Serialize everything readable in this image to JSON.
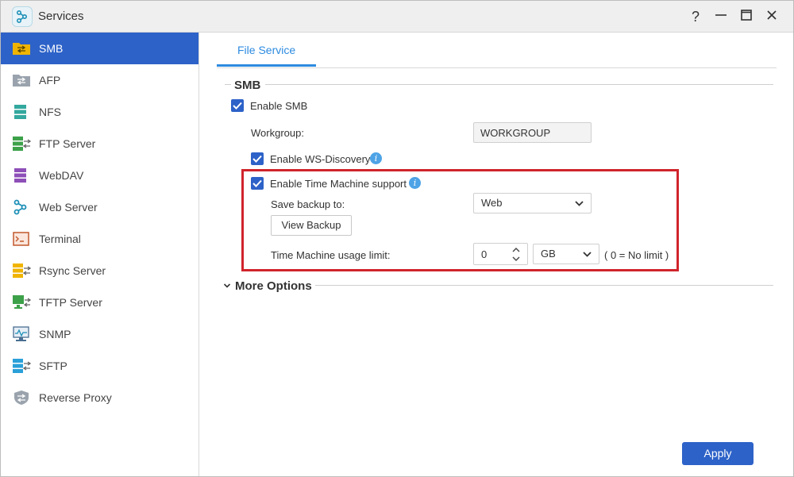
{
  "window": {
    "title": "Services",
    "controls": {
      "help": "?",
      "minimize": "—",
      "maximize": "☐",
      "close": "✕"
    }
  },
  "sidebar": {
    "items": [
      {
        "label": "SMB",
        "icon": "smb-icon",
        "active": true
      },
      {
        "label": "AFP",
        "icon": "afp-icon",
        "active": false
      },
      {
        "label": "NFS",
        "icon": "nfs-icon",
        "active": false
      },
      {
        "label": "FTP Server",
        "icon": "ftp-server-icon",
        "active": false
      },
      {
        "label": "WebDAV",
        "icon": "webdav-icon",
        "active": false
      },
      {
        "label": "Web Server",
        "icon": "web-server-icon",
        "active": false
      },
      {
        "label": "Terminal",
        "icon": "terminal-icon",
        "active": false
      },
      {
        "label": "Rsync Server",
        "icon": "rsync-server-icon",
        "active": false
      },
      {
        "label": "TFTP Server",
        "icon": "tftp-server-icon",
        "active": false
      },
      {
        "label": "SNMP",
        "icon": "snmp-icon",
        "active": false
      },
      {
        "label": "SFTP",
        "icon": "sftp-icon",
        "active": false
      },
      {
        "label": "Reverse Proxy",
        "icon": "reverse-proxy-icon",
        "active": false
      }
    ]
  },
  "tabs": [
    {
      "label": "File Service",
      "active": true
    }
  ],
  "smb_section": {
    "title": "SMB",
    "enable_smb": {
      "label": "Enable SMB",
      "checked": true
    },
    "workgroup": {
      "label": "Workgroup:",
      "value": "WORKGROUP"
    },
    "ws_discovery": {
      "label": "Enable WS-Discovery",
      "checked": true,
      "info": "i"
    },
    "time_machine": {
      "label": "Enable Time Machine support",
      "checked": true,
      "info": "i",
      "save_backup_label": "Save backup to:",
      "save_backup_value": "Web",
      "view_backup_button": "View Backup",
      "usage_limit_label": "Time Machine usage limit:",
      "usage_limit_value": "0",
      "usage_unit": "GB",
      "usage_hint": "( 0 = No limit )"
    }
  },
  "more_options": {
    "title": "More Options",
    "expanded": false
  },
  "footer": {
    "apply_label": "Apply"
  },
  "colors": {
    "accent": "#2d62c8",
    "tab_blue": "#2d8be0",
    "highlight": "#d0242c"
  }
}
